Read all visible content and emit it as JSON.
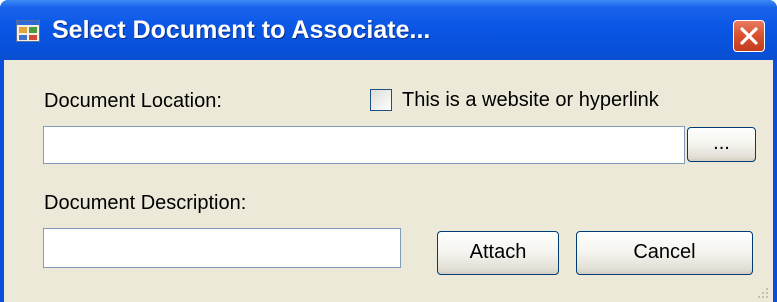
{
  "window": {
    "title": "Select Document to Associate...",
    "app_icon": "form-app-icon",
    "close_icon": "close-icon"
  },
  "form": {
    "document_location_label": "Document Location:",
    "document_location_value": "",
    "hyperlink_checkbox_label": "This is a website or hyperlink",
    "hyperlink_checked": false,
    "browse_button_label": "...",
    "document_description_label": "Document Description:",
    "document_description_value": ""
  },
  "buttons": {
    "attach_label": "Attach",
    "cancel_label": "Cancel"
  },
  "colors": {
    "title_bar": "#0a57e6",
    "close_button": "#d8502f",
    "client_background": "#ece9d8",
    "input_border": "#7f9db9",
    "button_border": "#003c74"
  }
}
